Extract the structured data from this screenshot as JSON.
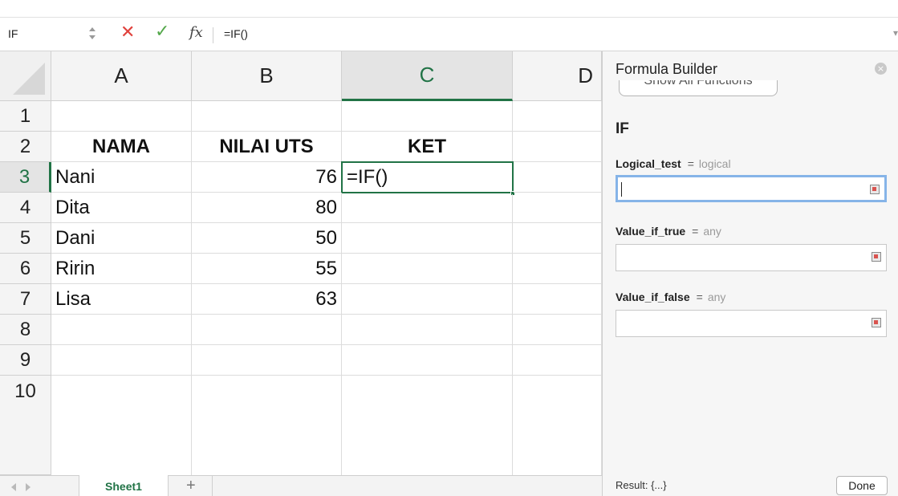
{
  "formula_bar": {
    "name_box": "IF",
    "cancel_glyph": "✕",
    "enter_glyph": "✓",
    "fx_label": "fx",
    "formula": "=IF()"
  },
  "columns": [
    "A",
    "B",
    "C",
    "D"
  ],
  "rows": [
    "1",
    "2",
    "3",
    "4",
    "5",
    "6",
    "7",
    "8",
    "9",
    "10"
  ],
  "cells": {
    "A2": "NAMA",
    "B2": "NILAI UTS",
    "C2": "KET",
    "A3": "Nani",
    "B3": "76",
    "C3": "=IF()",
    "A4": "Dita",
    "B4": "80",
    "A5": "Dani",
    "B5": "50",
    "A6": "Ririn",
    "B6": "55",
    "A7": "Lisa",
    "B7": "63"
  },
  "sheet_tabs": {
    "active": "Sheet1",
    "add_glyph": "+"
  },
  "formula_builder": {
    "title": "Formula Builder",
    "show_all": "Show All Functions",
    "function_name": "IF",
    "args": [
      {
        "name": "Logical_test",
        "eq": "=",
        "type": "logical"
      },
      {
        "name": "Value_if_true",
        "eq": "=",
        "type": "any"
      },
      {
        "name": "Value_if_false",
        "eq": "=",
        "type": "any"
      }
    ],
    "result": "Result: {...}",
    "done": "Done",
    "close_glyph": "×"
  }
}
